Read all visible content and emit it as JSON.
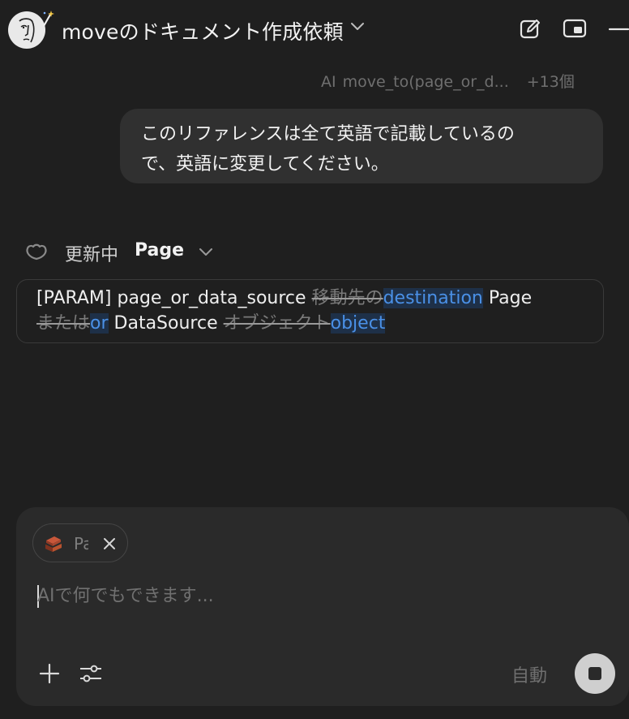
{
  "header": {
    "title": "moveのドキュメント作成依頼",
    "avatar_icon": "illustrated-face-avatar",
    "new_chat_icon": "compose-icon",
    "picture_in_picture_icon": "pip-icon",
    "minimize_icon": "minimize-icon"
  },
  "context": {
    "ai_label": "AI",
    "reference_label": "move_to(page_or_d...",
    "more_label": "+13個"
  },
  "messages": {
    "user_line1": "このリファレンスは全て英語で記載しているの",
    "user_line2": "で、英語に変更してください。"
  },
  "status": {
    "label": "更新中",
    "target": "Page"
  },
  "diff": {
    "prefix": "[PARAM] page_or_data_source ",
    "del1": "移動先の",
    "ins1": "destination",
    "mid1": " Page",
    "del2": "または",
    "ins2": "or",
    "mid2": " DataSource ",
    "del3": "オブジェクト",
    "ins3": "object"
  },
  "composer": {
    "attachment_label": "Page",
    "placeholder": "AIで何でもできます...",
    "mode_label": "自動"
  },
  "colors": {
    "background": "#1f1f1f",
    "bubble": "#303030",
    "composer": "#2a2a2a",
    "insert_text": "#4a90e6",
    "insert_bg": "#1e3048",
    "muted": "#6f6f6f"
  }
}
